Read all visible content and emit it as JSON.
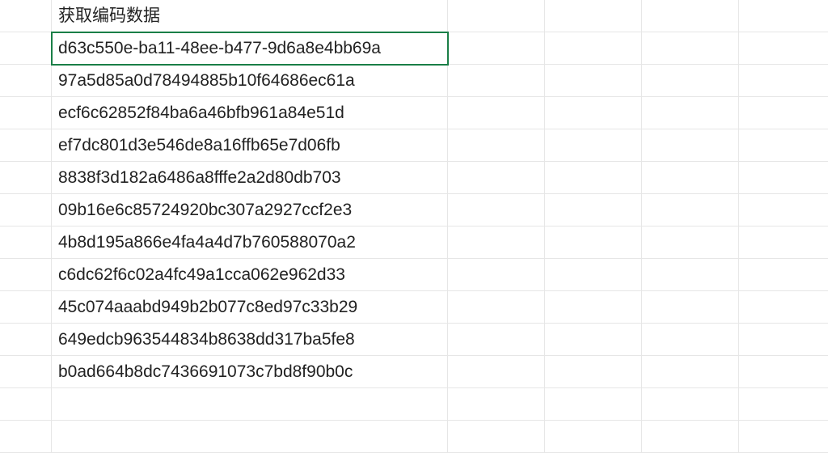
{
  "columns": {
    "A": "",
    "B_header": "获取编码数据",
    "B_rows": [
      "d63c550e-ba11-48ee-b477-9d6a8e4bb69a",
      "97a5d85a0d78494885b10f64686ec61a",
      "ecf6c62852f84ba6a46bfb961a84e51d",
      "ef7dc801d3e546de8a16ffb65e7d06fb",
      "8838f3d182a6486a8fffe2a2d80db703",
      "09b16e6c85724920bc307a2927ccf2e3",
      "4b8d195a866e4fa4a4d7b760588070a2",
      "c6dc62f6c02a4fc49a1cca062e962d33",
      "45c074aaabd949b2b077c8ed97c33b29",
      "649edcb963544834b8638dd317ba5fe8",
      "b0ad664b8dc7436691073c7bd8f90b0c"
    ]
  },
  "active_cell": "B2"
}
